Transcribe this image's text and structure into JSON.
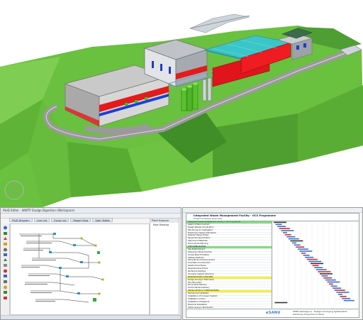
{
  "pid_window": {
    "title": "P&ID Editor - WWTP Sludge Digestion (Workspace)",
    "tabs": [
      "P&ID Diagram",
      "Line List",
      "Equip List",
      "Report View",
      "Spec Tables"
    ],
    "panel_title": "Plant Explorer",
    "panel_items": [
      "Main Drawing"
    ]
  },
  "gantt": {
    "title": "Integrated Waste Management Facility - OCS Programme",
    "subtitle": "Project Schedule Overview",
    "footer_title": "IWMF (Package 2) - Sludge Conveying System/OCS",
    "footer_subtitle": "Preliminary Programme of Works",
    "logo": "eSANU",
    "rows": [
      {
        "name": "Integrated Waste Management Facility - OCS Programme",
        "hl": "green"
      },
      {
        "name": "Award of Main Contract"
      },
      {
        "name": "Design Review Coordination"
      },
      {
        "name": "Site Survey & Investigation"
      },
      {
        "name": "Preliminary Design Submission"
      },
      {
        "name": "Detailed Design Phase"
      },
      {
        "name": "Equipment Specification"
      },
      {
        "name": "Approval of Materials"
      },
      {
        "name": "Procurement Planning"
      },
      {
        "name": "SITE MOBILISATION",
        "hl": "green"
      },
      {
        "name": "Site Establishment"
      },
      {
        "name": "Temporary Works Erection"
      },
      {
        "name": "Access Road Formation"
      },
      {
        "name": "Utilities Diversion"
      },
      {
        "name": "Piling Works Commencement"
      },
      {
        "name": "Foundation Construction"
      },
      {
        "name": "Substructure Works"
      },
      {
        "name": "Superstructure Frame"
      },
      {
        "name": "Roofing & Cladding"
      },
      {
        "name": "Conveyor Support Structure"
      },
      {
        "name": "MANUFACTURE & DELIVERY",
        "hl": "yellow"
      },
      {
        "name": "Sludge Conveyor Fabrication"
      },
      {
        "name": "Silo Fabrication"
      },
      {
        "name": "Pump Skids Delivery"
      },
      {
        "name": "Control Panels Delivery"
      },
      {
        "name": "INSTALLATION & COMMISSIONING",
        "hl": "yellow"
      },
      {
        "name": "Mechanical Installation"
      },
      {
        "name": "Installation of Conveyor System"
      },
      {
        "name": "Installation of Silos"
      },
      {
        "name": "Installation of Pipework"
      },
      {
        "name": "Electrical Installation"
      },
      {
        "name": "Cable Laying & Termination"
      },
      {
        "name": "Instrumentation Installation"
      },
      {
        "name": "Control System Integration"
      },
      {
        "name": "Pre-commissioning Tests"
      },
      {
        "name": "Dry Commissioning"
      },
      {
        "name": "Wet Commissioning"
      },
      {
        "name": "Performance Testing"
      },
      {
        "name": "Reliability Run"
      },
      {
        "name": "Handover & Completion",
        "hl": "blue"
      }
    ]
  },
  "colors": {
    "grass": "#6dbf45",
    "hill": "#4e9e33",
    "road": "#9a9a9a",
    "building_grey": "#b9b9b9",
    "red": "#e0141b",
    "teal": "#2fc0c0",
    "green_silo": "#58c22d"
  }
}
